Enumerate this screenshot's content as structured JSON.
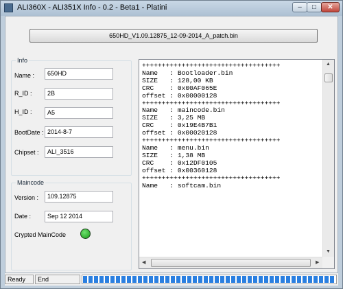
{
  "window": {
    "title": "ALI360X - ALI351X  Info - 0.2 - Beta1 - Platini",
    "minimize": "–",
    "maximize": "□",
    "close": "✕"
  },
  "file_button": {
    "label": "650HD_V1.09.12875_12-09-2014_A_patch.bin"
  },
  "info": {
    "legend": "Info",
    "fields": {
      "name": {
        "label": "Name :",
        "value": "650HD"
      },
      "r_id": {
        "label": "R_ID :",
        "value": "2B"
      },
      "h_id": {
        "label": "H_ID :",
        "value": "A5"
      },
      "bootdate": {
        "label": "BootDate :",
        "value": "2014-8-7"
      },
      "chipset": {
        "label": "Chipset :",
        "value": "ALI_3516"
      }
    }
  },
  "maincode": {
    "legend": "Maincode",
    "version": {
      "label": "Version :",
      "value": "109.12875"
    },
    "date": {
      "label": "Date :",
      "value": "Sep 12 2014"
    },
    "crypted": {
      "label": "Crypted MainCode",
      "status_color": "#169a16"
    }
  },
  "log": {
    "text": "+++++++++++++++++++++++++++++++++++\nName   : Bootloader.bin\nSIZE   : 128,00 KB\nCRC    : 0x00AF065E\noffset : 0x00000128\n+++++++++++++++++++++++++++++++++++\nName   : maincode.bin\nSIZE   : 3,25 MB\nCRC    : 0x19E4B7B1\noffset : 0x00020128\n+++++++++++++++++++++++++++++++++++\nName   : menu.bin\nSIZE   : 1,38 MB\nCRC    : 0x12DF0105\noffset : 0x00360128\n+++++++++++++++++++++++++++++++++++\nName   : softcam.bin"
  },
  "status": {
    "ready": "Ready",
    "end": "End",
    "progress": 1.0,
    "progress_color": "#2a7fe0"
  },
  "icons": {
    "app": "app-icon",
    "scroll_up": "▲",
    "scroll_down": "▼",
    "scroll_left": "◀",
    "scroll_right": "▶"
  }
}
